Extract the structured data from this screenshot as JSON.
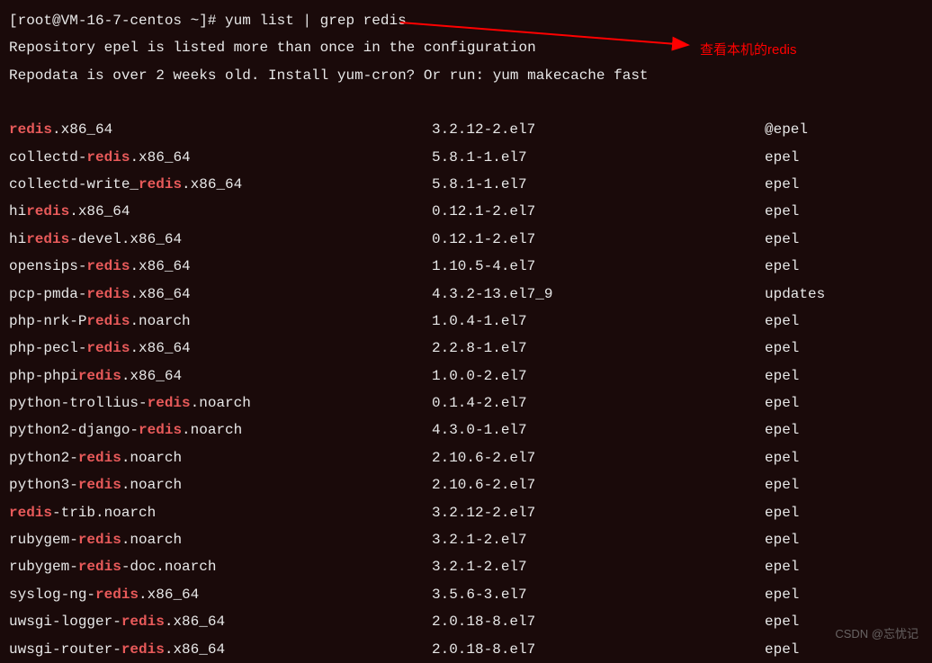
{
  "prompt": "[root@VM-16-7-centos ~]# yum list | grep redis",
  "messages": [
    "Repository epel is listed more than once in the configuration",
    "Repodata is over 2 weeks old. Install yum-cron? Or run: yum makecache fast"
  ],
  "annotation": "查看本机的redis",
  "watermark": "CSDN @忘忧记",
  "packages": [
    {
      "prefix": "",
      "match": "redis",
      "suffix": ".x86_64",
      "version": "3.2.12-2.el7",
      "repo": "@epel"
    },
    {
      "prefix": "collectd-",
      "match": "redis",
      "suffix": ".x86_64",
      "version": "5.8.1-1.el7",
      "repo": "epel"
    },
    {
      "prefix": "collectd-write_",
      "match": "redis",
      "suffix": ".x86_64",
      "version": "5.8.1-1.el7",
      "repo": "epel"
    },
    {
      "prefix": "hi",
      "match": "redis",
      "suffix": ".x86_64",
      "version": "0.12.1-2.el7",
      "repo": "epel"
    },
    {
      "prefix": "hi",
      "match": "redis",
      "suffix": "-devel.x86_64",
      "version": "0.12.1-2.el7",
      "repo": "epel"
    },
    {
      "prefix": "opensips-",
      "match": "redis",
      "suffix": ".x86_64",
      "version": "1.10.5-4.el7",
      "repo": "epel"
    },
    {
      "prefix": "pcp-pmda-",
      "match": "redis",
      "suffix": ".x86_64",
      "version": "4.3.2-13.el7_9",
      "repo": "updates"
    },
    {
      "prefix": "php-nrk-P",
      "match": "redis",
      "suffix": ".noarch",
      "version": "1.0.4-1.el7",
      "repo": "epel"
    },
    {
      "prefix": "php-pecl-",
      "match": "redis",
      "suffix": ".x86_64",
      "version": "2.2.8-1.el7",
      "repo": "epel"
    },
    {
      "prefix": "php-phpi",
      "match": "redis",
      "suffix": ".x86_64",
      "version": "1.0.0-2.el7",
      "repo": "epel"
    },
    {
      "prefix": "python-trollius-",
      "match": "redis",
      "suffix": ".noarch",
      "version": "0.1.4-2.el7",
      "repo": "epel"
    },
    {
      "prefix": "python2-django-",
      "match": "redis",
      "suffix": ".noarch",
      "version": "4.3.0-1.el7",
      "repo": "epel"
    },
    {
      "prefix": "python2-",
      "match": "redis",
      "suffix": ".noarch",
      "version": "2.10.6-2.el7",
      "repo": "epel"
    },
    {
      "prefix": "python3-",
      "match": "redis",
      "suffix": ".noarch",
      "version": "2.10.6-2.el7",
      "repo": "epel"
    },
    {
      "prefix": "",
      "match": "redis",
      "suffix": "-trib.noarch",
      "version": "3.2.12-2.el7",
      "repo": "epel"
    },
    {
      "prefix": "rubygem-",
      "match": "redis",
      "suffix": ".noarch",
      "version": "3.2.1-2.el7",
      "repo": "epel"
    },
    {
      "prefix": "rubygem-",
      "match": "redis",
      "suffix": "-doc.noarch",
      "version": "3.2.1-2.el7",
      "repo": "epel"
    },
    {
      "prefix": "syslog-ng-",
      "match": "redis",
      "suffix": ".x86_64",
      "version": "3.5.6-3.el7",
      "repo": "epel"
    },
    {
      "prefix": "uwsgi-logger-",
      "match": "redis",
      "suffix": ".x86_64",
      "version": "2.0.18-8.el7",
      "repo": "epel"
    },
    {
      "prefix": "uwsgi-router-",
      "match": "redis",
      "suffix": ".x86_64",
      "version": "2.0.18-8.el7",
      "repo": "epel"
    }
  ]
}
